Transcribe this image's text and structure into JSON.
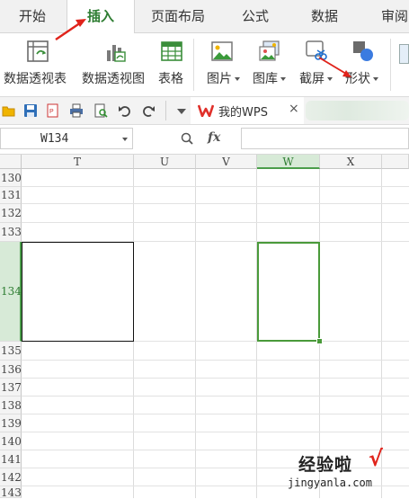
{
  "ribbon_tabs": [
    {
      "label": "开始",
      "active": false
    },
    {
      "label": "插入",
      "active": true
    },
    {
      "label": "页面布局",
      "active": false
    },
    {
      "label": "公式",
      "active": false
    },
    {
      "label": "数据",
      "active": false
    },
    {
      "label": "审阅",
      "active": false
    }
  ],
  "ribbon_buttons": [
    {
      "label": "数据透视表",
      "icon": "pivot-table-icon",
      "dropdown": false
    },
    {
      "label": "数据透视图",
      "icon": "pivot-chart-icon",
      "dropdown": false
    },
    {
      "label": "表格",
      "icon": "table-icon",
      "dropdown": false
    },
    {
      "label": "图片",
      "icon": "picture-icon",
      "dropdown": true
    },
    {
      "label": "图库",
      "icon": "gallery-icon",
      "dropdown": true
    },
    {
      "label": "截屏",
      "icon": "screenshot-icon",
      "dropdown": true
    },
    {
      "label": "形状",
      "icon": "shapes-icon",
      "dropdown": true
    }
  ],
  "doc_tab": {
    "name": "我的WPS",
    "close_glyph": "×"
  },
  "formula_bar": {
    "name_box": "W134",
    "fx_label": "fx",
    "value": ""
  },
  "columns": [
    "T",
    "U",
    "V",
    "W",
    "X"
  ],
  "selected_column": "W",
  "rows": [
    "130",
    "131",
    "132",
    "133",
    "134",
    "135",
    "136",
    "137",
    "138",
    "139",
    "140",
    "141",
    "142",
    "143"
  ],
  "selected_row": "134",
  "watermark": {
    "line1": "经验啦",
    "check": "√",
    "line2": "jingyanla.com"
  },
  "colors": {
    "accent_green": "#2e7d32",
    "selection_green": "#4a9a3a",
    "annotation_red": "#e0231b"
  }
}
